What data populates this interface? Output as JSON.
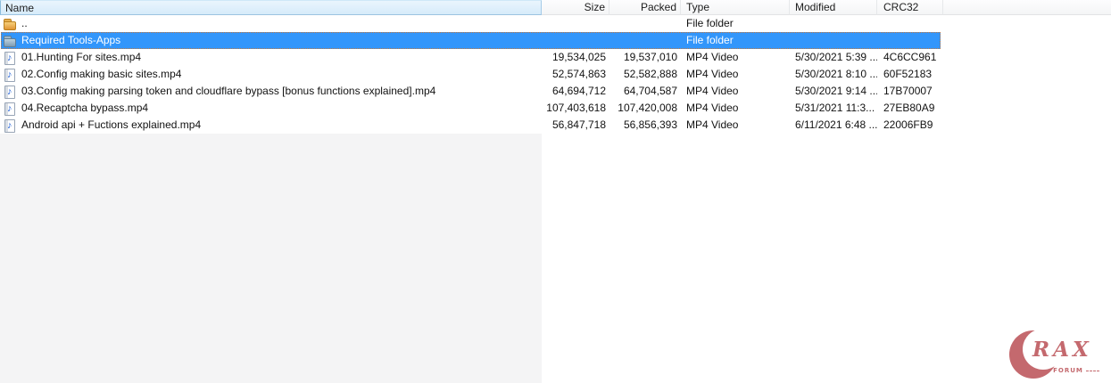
{
  "header": {
    "columns": [
      {
        "id": "name",
        "label": "Name"
      },
      {
        "id": "size",
        "label": "Size"
      },
      {
        "id": "packed",
        "label": "Packed"
      },
      {
        "id": "type",
        "label": "Type"
      },
      {
        "id": "modified",
        "label": "Modified"
      },
      {
        "id": "crc32",
        "label": "CRC32"
      }
    ]
  },
  "rows": [
    {
      "name": "..",
      "size": "",
      "packed": "",
      "type": "File folder",
      "modified": "",
      "crc32": "",
      "icon": "folder-up",
      "selected": false
    },
    {
      "name": "Required Tools-Apps",
      "size": "",
      "packed": "",
      "type": "File folder",
      "modified": "",
      "crc32": "",
      "icon": "folder",
      "selected": true
    },
    {
      "name": "01.Hunting For sites.mp4",
      "size": "19,534,025",
      "packed": "19,537,010",
      "type": "MP4 Video",
      "modified": "5/30/2021 5:39 ...",
      "crc32": "4C6CC961",
      "icon": "media-file",
      "selected": false
    },
    {
      "name": "02.Config making basic sites.mp4",
      "size": "52,574,863",
      "packed": "52,582,888",
      "type": "MP4 Video",
      "modified": "5/30/2021 8:10 ...",
      "crc32": "60F52183",
      "icon": "media-file",
      "selected": false
    },
    {
      "name": "03.Config making parsing token and cloudflare bypass [bonus functions explained].mp4",
      "size": "64,694,712",
      "packed": "64,704,587",
      "type": "MP4 Video",
      "modified": "5/30/2021 9:14 ...",
      "crc32": "17B70007",
      "icon": "media-file",
      "selected": false
    },
    {
      "name": "04.Recaptcha bypass.mp4",
      "size": "107,403,618",
      "packed": "107,420,008",
      "type": "MP4 Video",
      "modified": "5/31/2021 11:3...",
      "crc32": "27EB80A9",
      "icon": "media-file",
      "selected": false
    },
    {
      "name": "Android api + Fuctions explained.mp4",
      "size": "56,847,718",
      "packed": "56,856,393",
      "type": "MP4 Video",
      "modified": "6/11/2021 6:48 ...",
      "crc32": "22006FB9",
      "icon": "media-file",
      "selected": false
    }
  ],
  "logo": {
    "rax": "RAX",
    "forum": "FORUM",
    "color": "#c4696e"
  },
  "colors": {
    "selection": "#3296fb",
    "selection_border": "#c07840",
    "sorted_header_bg": "#d6ebfa",
    "name_column_shade": "#f4f4f5"
  }
}
